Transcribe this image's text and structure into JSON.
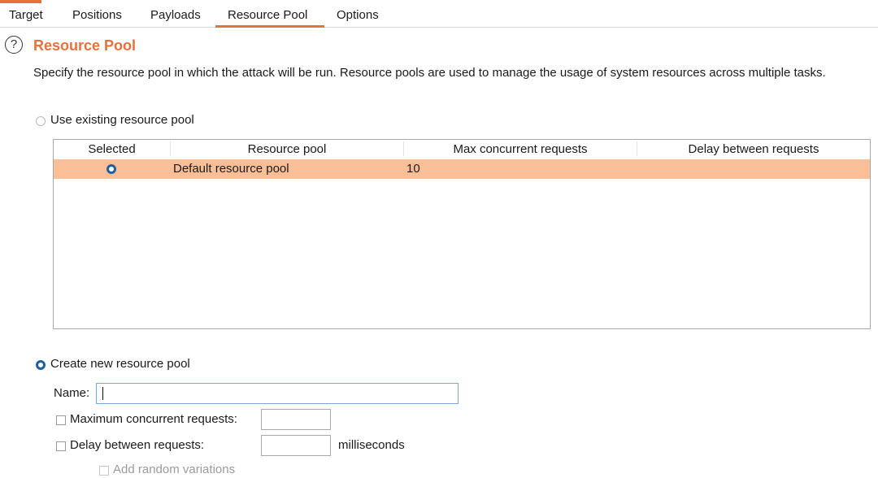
{
  "tabs": [
    "Target",
    "Positions",
    "Payloads",
    "Resource Pool",
    "Options"
  ],
  "active_tab": "Resource Pool",
  "section": {
    "title": "Resource Pool",
    "description": "Specify the resource pool in which the attack will be run. Resource pools are used to manage the usage of system resources across multiple tasks."
  },
  "existing": {
    "radio_label": "Use existing resource pool",
    "selected": false,
    "columns": [
      "Selected",
      "Resource pool",
      "Max concurrent requests",
      "Delay between requests"
    ],
    "rows": [
      {
        "selected": true,
        "name": "Default resource pool",
        "max_concurrent": "10",
        "delay": ""
      }
    ]
  },
  "create": {
    "radio_label": "Create new resource pool",
    "selected": true,
    "name_label": "Name:",
    "name_value": "",
    "max_label": "Maximum concurrent requests:",
    "max_value": "",
    "delay_label": "Delay between requests:",
    "delay_value": "",
    "delay_unit": "milliseconds",
    "random_label": "Add random variations"
  },
  "colors": {
    "accent": "#e8703a",
    "selected_row": "#fbbf98",
    "radio_on": "#1f5fa3"
  }
}
